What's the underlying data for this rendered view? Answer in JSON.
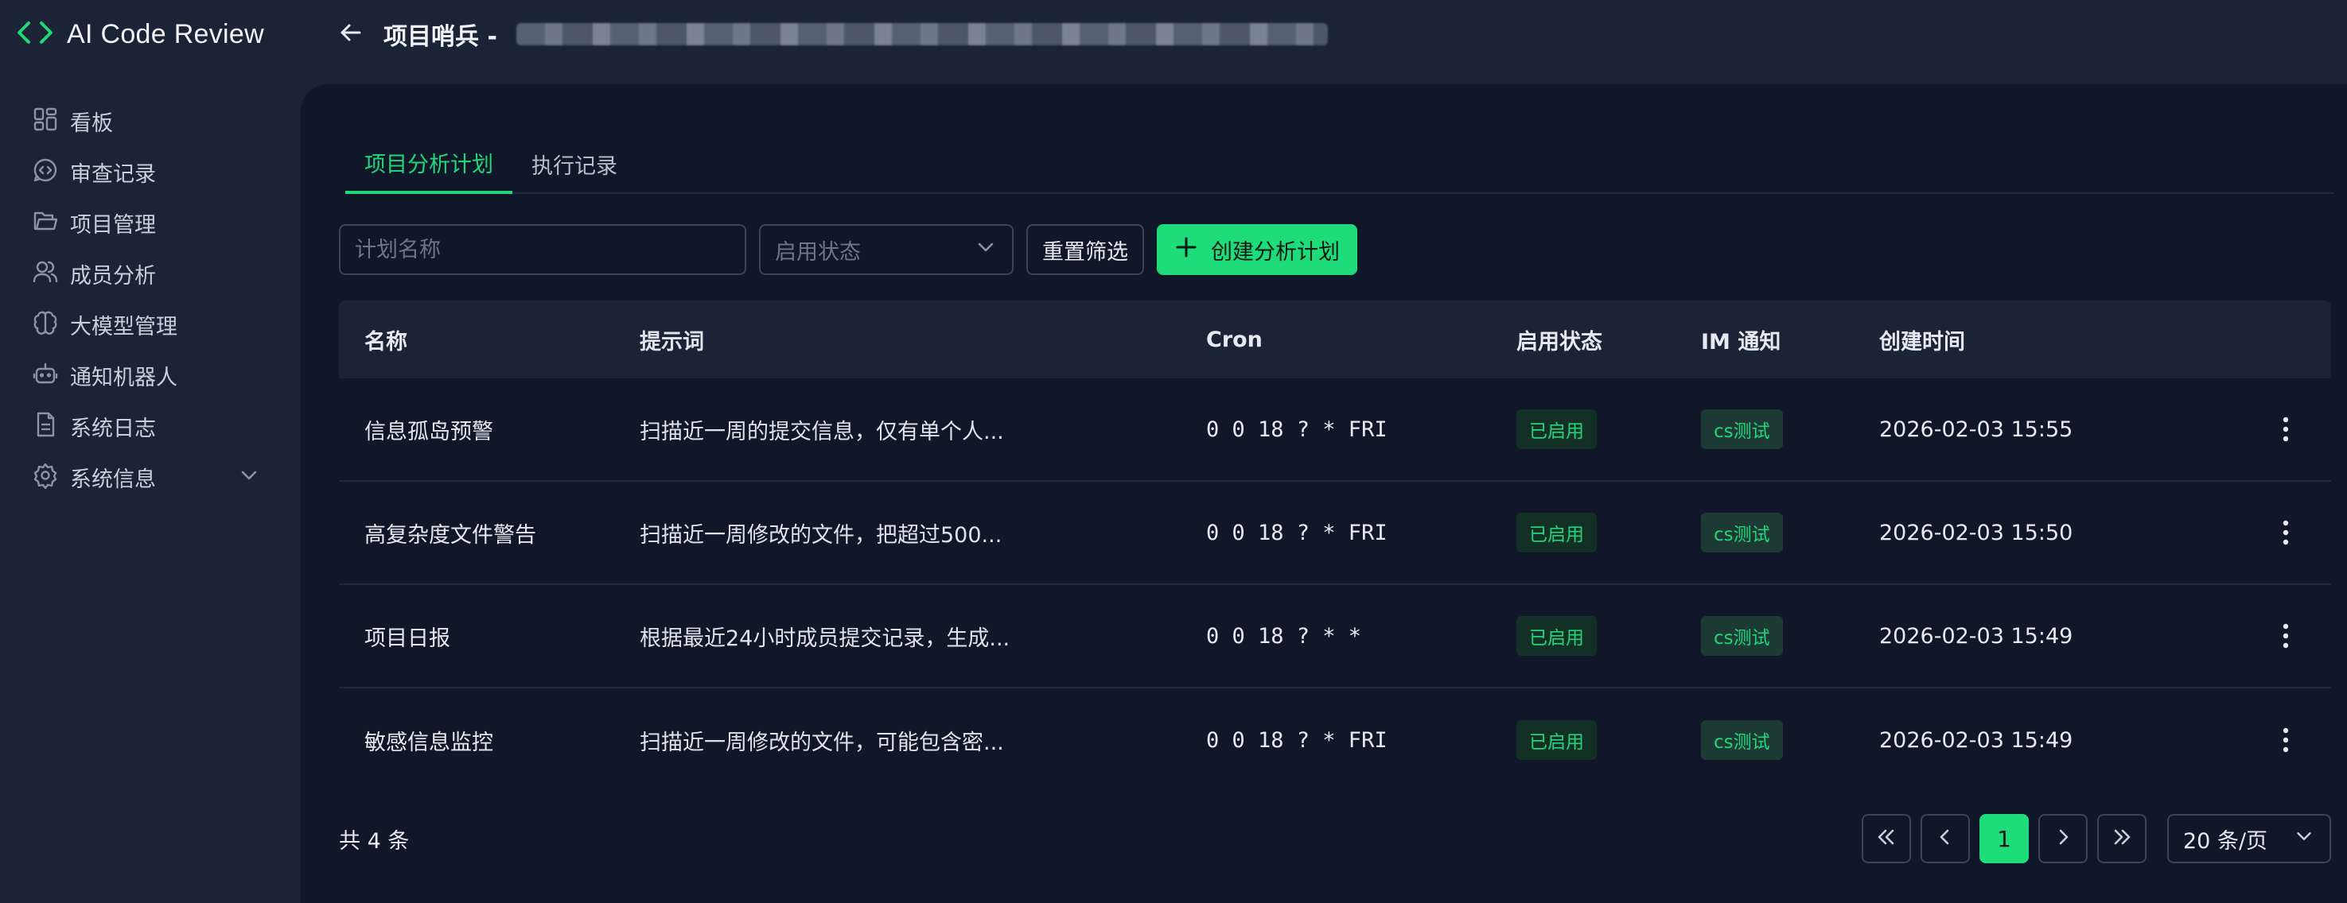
{
  "app": {
    "title": "AI Code Review",
    "accent": "#1fdc7b"
  },
  "header": {
    "title": "项目哨兵 -"
  },
  "sidebar": {
    "items": [
      {
        "label": "看板",
        "icon": "dashboard-icon"
      },
      {
        "label": "审查记录",
        "icon": "review-icon"
      },
      {
        "label": "项目管理",
        "icon": "folder-icon"
      },
      {
        "label": "成员分析",
        "icon": "users-icon"
      },
      {
        "label": "大模型管理",
        "icon": "brain-icon"
      },
      {
        "label": "通知机器人",
        "icon": "robot-icon"
      },
      {
        "label": "系统日志",
        "icon": "log-icon"
      },
      {
        "label": "系统信息",
        "icon": "gear-icon"
      }
    ]
  },
  "tabs": [
    {
      "label": "项目分析计划",
      "active": true
    },
    {
      "label": "执行记录",
      "active": false
    }
  ],
  "toolbar": {
    "name_placeholder": "计划名称",
    "status_placeholder": "启用状态",
    "reset_label": "重置筛选",
    "create_label": "创建分析计划"
  },
  "table": {
    "columns": [
      "名称",
      "提示词",
      "Cron",
      "启用状态",
      "IM 通知",
      "创建时间"
    ],
    "rows": [
      {
        "name": "信息孤岛预警",
        "prompt": "扫描近一周的提交信息，仅有单个人...",
        "cron": "0 0 18 ? * FRI",
        "status": "已启用",
        "im": "cs测试",
        "created": "2026-02-03 15:55"
      },
      {
        "name": "高复杂度文件警告",
        "prompt": "扫描近一周修改的文件，把超过500...",
        "cron": "0 0 18 ? * FRI",
        "status": "已启用",
        "im": "cs测试",
        "created": "2026-02-03 15:50"
      },
      {
        "name": "项目日报",
        "prompt": "根据最近24小时成员提交记录，生成...",
        "cron": "0 0 18 ? * *",
        "status": "已启用",
        "im": "cs测试",
        "created": "2026-02-03 15:49"
      },
      {
        "name": "敏感信息监控",
        "prompt": "扫描近一周修改的文件，可能包含密...",
        "cron": "0 0 18 ? * FRI",
        "status": "已启用",
        "im": "cs测试",
        "created": "2026-02-03 15:49"
      }
    ]
  },
  "footer": {
    "total": "共 4 条",
    "current_page": "1",
    "page_size": "20 条/页"
  }
}
